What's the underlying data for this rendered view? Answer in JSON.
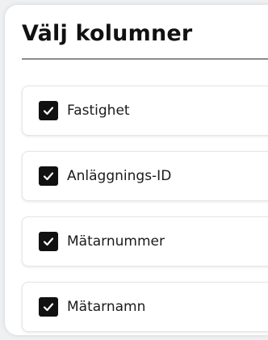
{
  "dialog": {
    "title": "Välj kolumner",
    "options": [
      {
        "label": "Fastighet",
        "checked": true
      },
      {
        "label": "Anläggnings-ID",
        "checked": true
      },
      {
        "label": "Mätarnummer",
        "checked": true
      },
      {
        "label": "Mätarnamn",
        "checked": true
      }
    ]
  },
  "colors": {
    "checkbox_fill": "#111111",
    "checkmark": "#ffffff",
    "divider": "#8c8c8c"
  }
}
